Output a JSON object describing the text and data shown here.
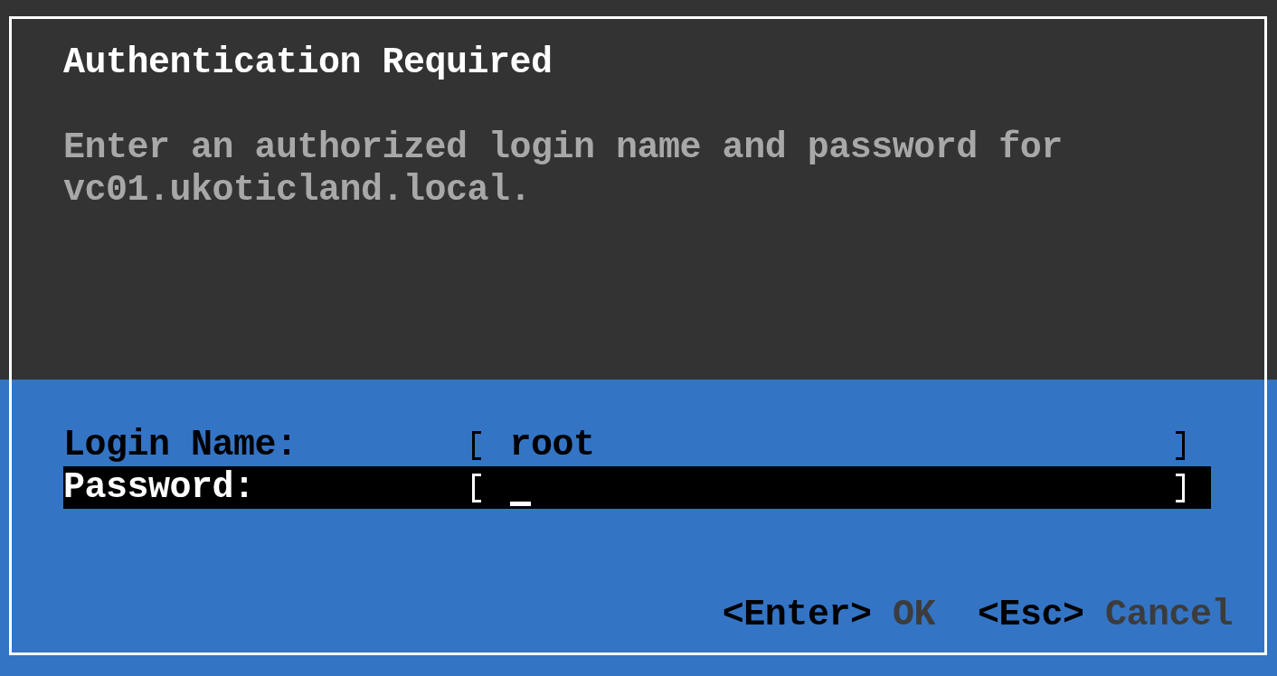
{
  "dialog": {
    "title": "Authentication Required",
    "message": "Enter an authorized login name and password for vc01.ukoticland.local.",
    "fields": [
      {
        "label": "Login Name:",
        "value": "root",
        "selected": false
      },
      {
        "label": "Password:",
        "selected": true
      }
    ],
    "actions": [
      {
        "key": "<Enter>",
        "label": "OK"
      },
      {
        "key": "<Esc>",
        "label": "Cancel"
      }
    ]
  }
}
